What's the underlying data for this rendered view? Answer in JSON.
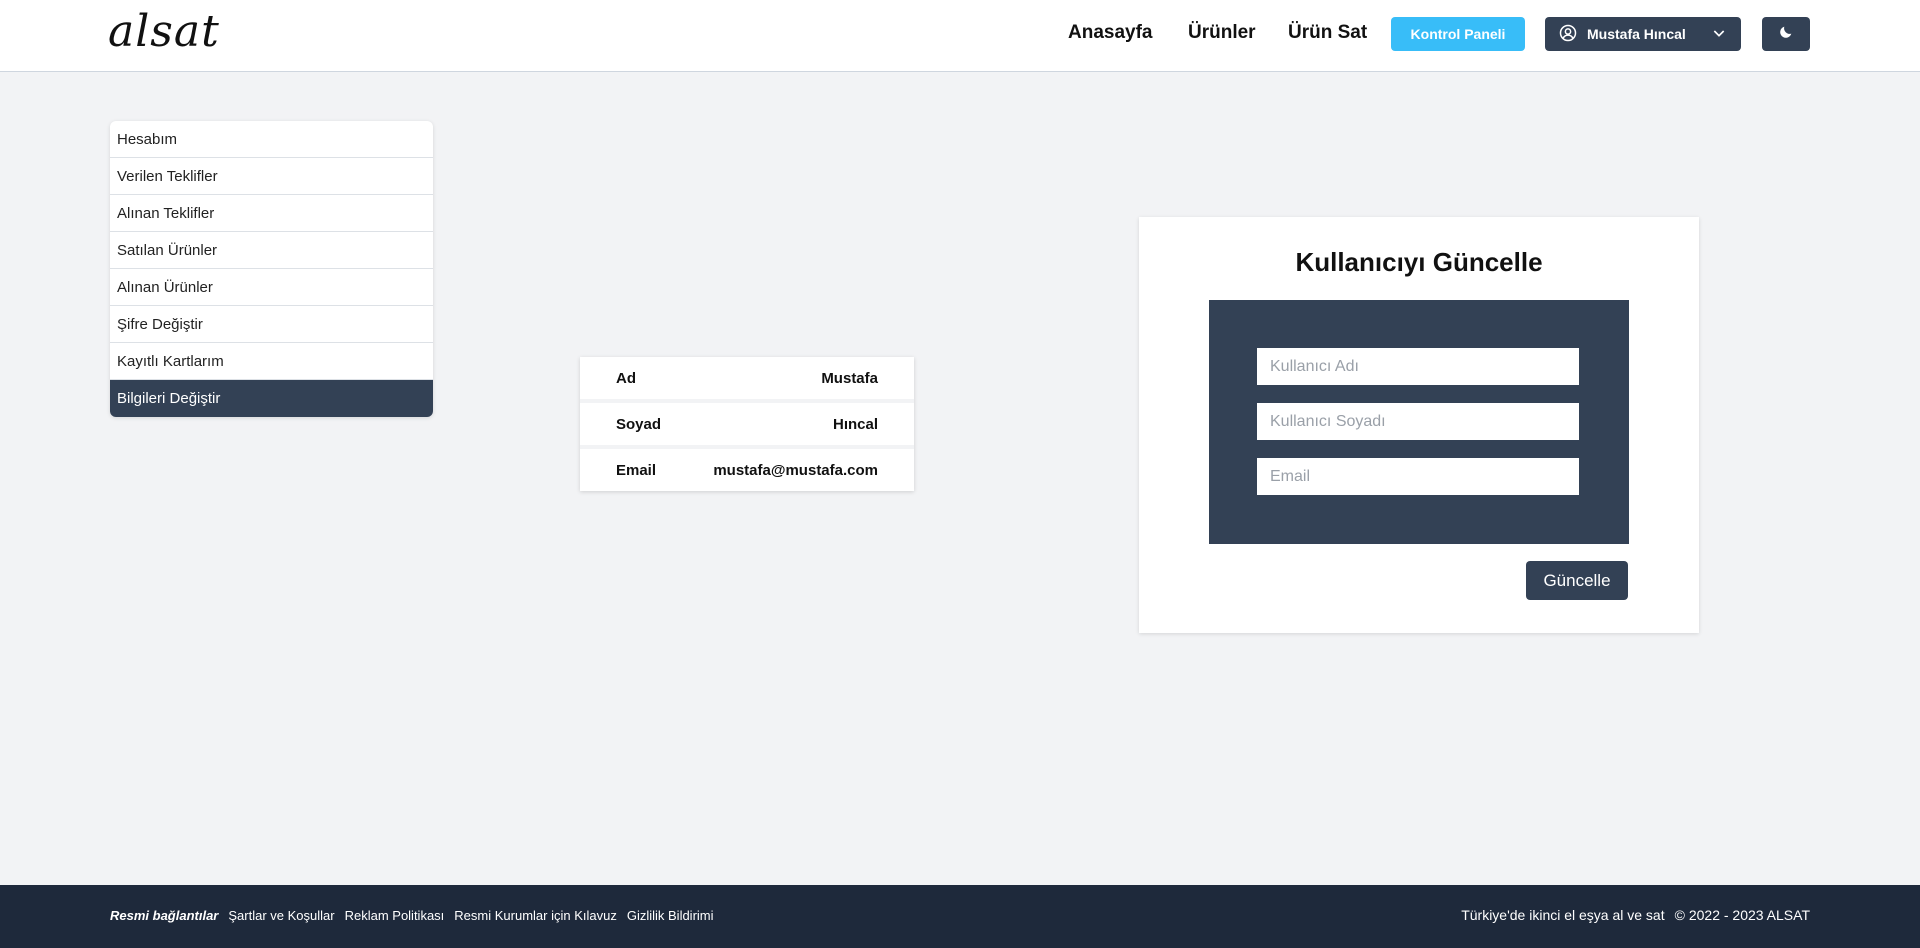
{
  "header": {
    "logo": "alsat",
    "nav": {
      "home": "Anasayfa",
      "products": "Ürünler",
      "sell": "Ürün Sat"
    },
    "panel_button": "Kontrol Paneli",
    "user_name": "Mustafa Hıncal",
    "icons": {
      "user": "user-circle-icon",
      "dropdown": "chevron-down-icon",
      "theme": "moon-icon"
    }
  },
  "sidebar": {
    "items": [
      {
        "label": "Hesabım"
      },
      {
        "label": "Verilen Teklifler"
      },
      {
        "label": "Alınan Teklifler"
      },
      {
        "label": "Satılan Ürünler"
      },
      {
        "label": "Alınan Ürünler"
      },
      {
        "label": "Şifre Değiştir"
      },
      {
        "label": "Kayıtlı Kartlarım"
      },
      {
        "label": "Bilgileri Değiştir"
      }
    ],
    "active_index": 7
  },
  "info": {
    "rows": [
      {
        "label": "Ad",
        "value": "Mustafa"
      },
      {
        "label": "Soyad",
        "value": "Hıncal"
      },
      {
        "label": "Email",
        "value": "mustafa@mustafa.com"
      }
    ]
  },
  "update_form": {
    "title": "Kullanıcıyı Güncelle",
    "name_placeholder": "Kullanıcı Adı",
    "surname_placeholder": "Kullanıcı Soyadı",
    "email_placeholder": "Email",
    "submit_label": "Güncelle"
  },
  "footer": {
    "links": [
      "Resmi bağlantılar",
      "Şartlar ve Koşullar",
      "Reklam Politikası",
      "Resmi Kurumlar için Kılavuz",
      "Gizlilik Bildirimi"
    ],
    "tagline": "Türkiye'de ikinci el eşya al ve sat",
    "copyright": "© 2022 - 2023 ALSAT"
  },
  "colors": {
    "accent": "#38bdf8",
    "primary_dark": "#334155",
    "footer_bg": "#1e293b",
    "page_bg": "#f2f3f5"
  }
}
